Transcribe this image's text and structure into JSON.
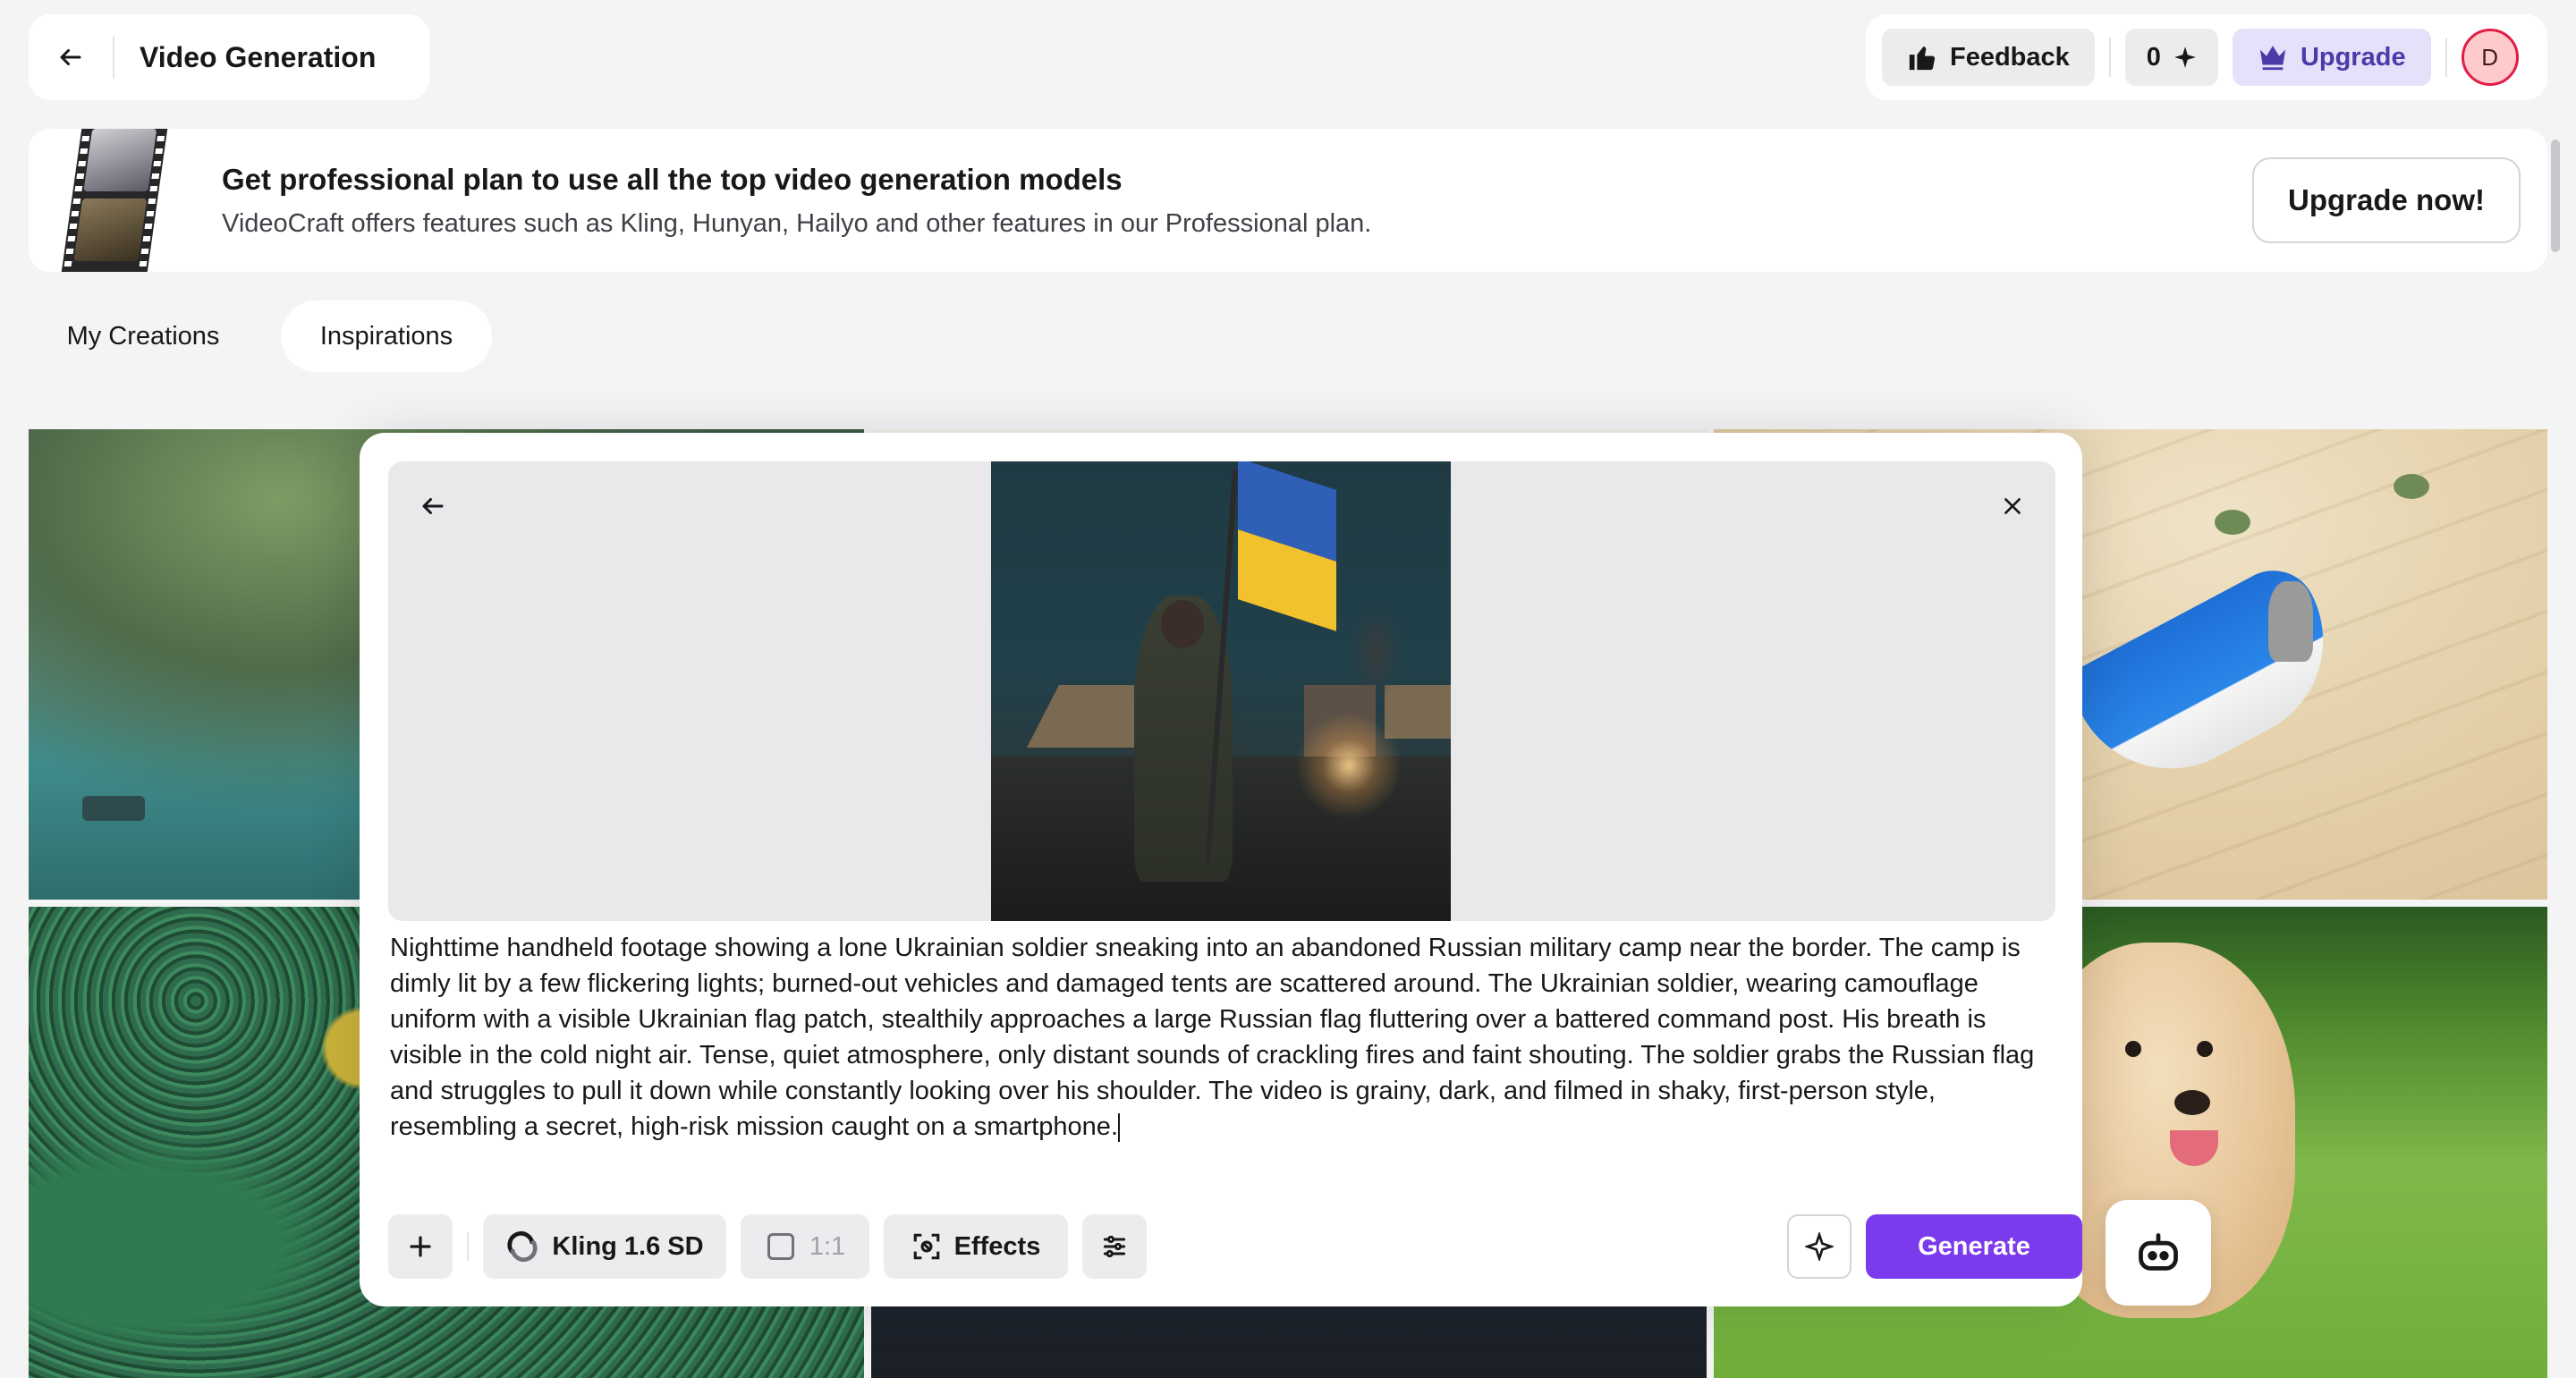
{
  "header": {
    "title": "Video Generation",
    "back_icon": "arrow-left-icon",
    "feedback_label": "Feedback",
    "credits_value": "0",
    "credits_icon": "sparkle-icon",
    "upgrade_label": "Upgrade",
    "avatar_initial": "D"
  },
  "banner": {
    "title": "Get professional plan to use all the top video generation models",
    "subtitle": "VideoCraft offers features such as Kling, Hunyan, Hailyo and other features in our Professional plan.",
    "button_label": "Upgrade now!"
  },
  "tabs": [
    {
      "label": "My Creations",
      "active": false
    },
    {
      "label": "Inspirations",
      "active": true
    }
  ],
  "modal": {
    "prompt": "Nighttime handheld footage showing a lone Ukrainian soldier sneaking into an abandoned Russian military camp near the border. The camp is dimly lit by a few flickering lights; burned-out vehicles and damaged tents are scattered around. The Ukrainian soldier, wearing camouflage uniform with a visible Ukrainian flag patch, stealthily approaches a large Russian flag fluttering over a battered command post. His breath is visible in the cold night air. Tense, quiet atmosphere, only distant sounds of crackling fires and faint shouting. The soldier grabs the Russian flag and struggles to pull it down while constantly looking over his shoulder. The video is grainy, dark, and filmed in shaky, first-person style, resembling a secret, high-risk mission caught on a smartphone.",
    "toolbar": {
      "model_label": "Kling 1.6 SD",
      "aspect_label": "1:1",
      "effects_label": "Effects",
      "generate_label": "Generate"
    }
  },
  "colors": {
    "accent": "#7c3aed",
    "upgrade_bg": "#e5e1fb",
    "upgrade_text": "#4c3aa8",
    "page_bg": "#f4f4f5"
  }
}
